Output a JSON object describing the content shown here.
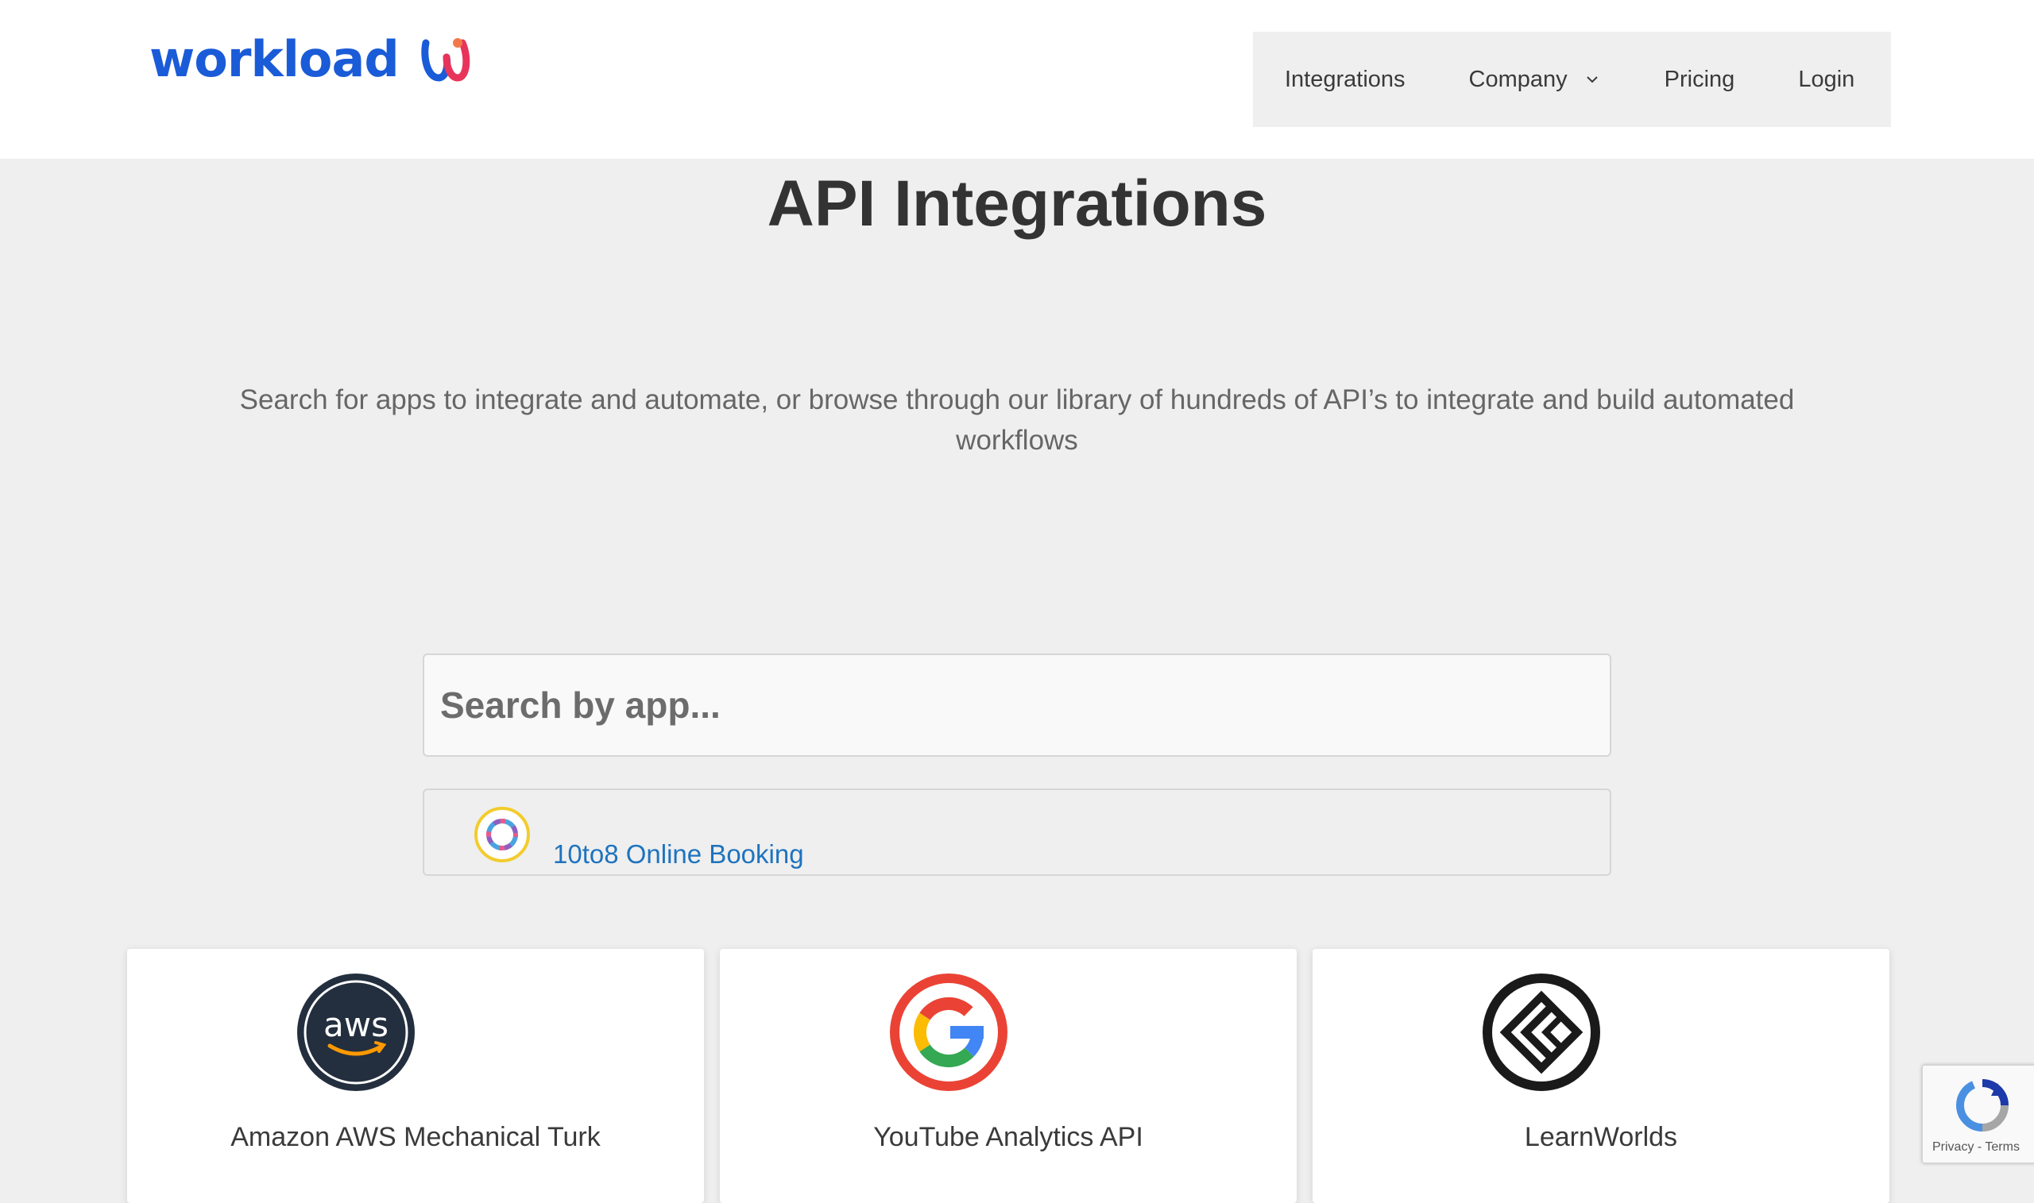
{
  "brand": {
    "logo_text": "workload",
    "color": "#1a5bd8"
  },
  "nav": {
    "items": [
      {
        "label": "Integrations"
      },
      {
        "label": "Company",
        "icon": "chevron-down-icon"
      },
      {
        "label": "Pricing"
      },
      {
        "label": "Login"
      }
    ]
  },
  "hero": {
    "title": "API Integrations",
    "subtitle": "Search for apps to integrate and automate, or browse through our library of hundreds of API’s to integrate and build automated workflows"
  },
  "search": {
    "placeholder": "Search by app..."
  },
  "search_result": {
    "label": "10to8 Online Booking",
    "icon": "ring-logo-icon",
    "link_color": "#1e73be"
  },
  "cards": [
    {
      "title": "Amazon AWS Mechanical Turk",
      "icon": "aws-icon"
    },
    {
      "title": "YouTube Analytics API",
      "icon": "google-icon"
    },
    {
      "title": "LearnWorlds",
      "icon": "learnworlds-icon"
    }
  ],
  "recaptcha": {
    "privacy": "Privacy",
    "separator": " - ",
    "terms": "Terms"
  }
}
